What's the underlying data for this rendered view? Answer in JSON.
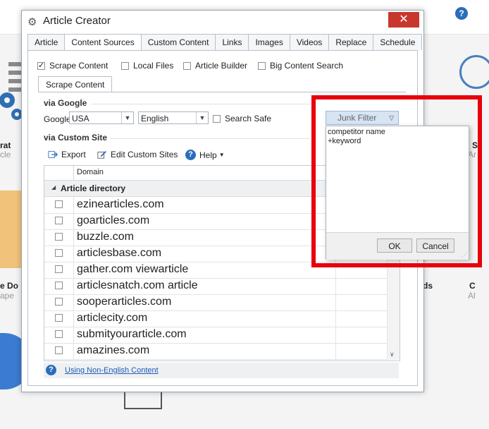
{
  "window": {
    "title": "Article Creator",
    "close_glyph": "✕"
  },
  "tabs": [
    {
      "label": "Article"
    },
    {
      "label": "Content Sources"
    },
    {
      "label": "Custom Content"
    },
    {
      "label": "Links"
    },
    {
      "label": "Images"
    },
    {
      "label": "Videos"
    },
    {
      "label": "Replace"
    },
    {
      "label": "Schedule"
    }
  ],
  "sources": {
    "scrape_content": {
      "label": "Scrape Content",
      "checked": true
    },
    "local_files": {
      "label": "Local Files",
      "checked": false
    },
    "article_builder": {
      "label": "Article Builder",
      "checked": false
    },
    "big_content_search": {
      "label": "Big Content Search",
      "checked": false
    }
  },
  "subtab": {
    "label": "Scrape Content"
  },
  "google": {
    "section_title": "via Google",
    "label": "Google",
    "country": "USA",
    "language": "English",
    "safe_search_label": "Search Safe"
  },
  "custom_site": {
    "section_title": "via Custom Site",
    "export_label": "Export",
    "edit_label": "Edit Custom Sites",
    "help_label": "Help"
  },
  "grid": {
    "domain_header": "Domain",
    "group_label": "Article directory",
    "rows": [
      "ezinearticles.com",
      "goarticles.com",
      "buzzle.com",
      "articlesbase.com",
      "gather.com viewarticle",
      "articlesnatch.com article",
      "sooperarticles.com",
      "articlecity.com",
      "submityourarticle.com",
      "amazines.com"
    ]
  },
  "footer": {
    "link_label": "Using Non-English Content"
  },
  "junk_filter": {
    "button_label": "Junk Filter",
    "text": "competitor name\n+keyword",
    "ok_label": "OK",
    "cancel_label": "Cancel"
  },
  "background": {
    "text_left_1": "rat",
    "text_left_2": "cle",
    "text_right_1": "S",
    "text_right_2": "Ar",
    "text_left_3": "e Do",
    "text_left_4": "ape",
    "text_right_3": "ds",
    "text_right_4": "C",
    "text_right_5": "Al"
  },
  "colors": {
    "highlight": "#e8000b",
    "close": "#c8372d",
    "link": "#1e5bb8",
    "help": "#2a6ebb"
  }
}
